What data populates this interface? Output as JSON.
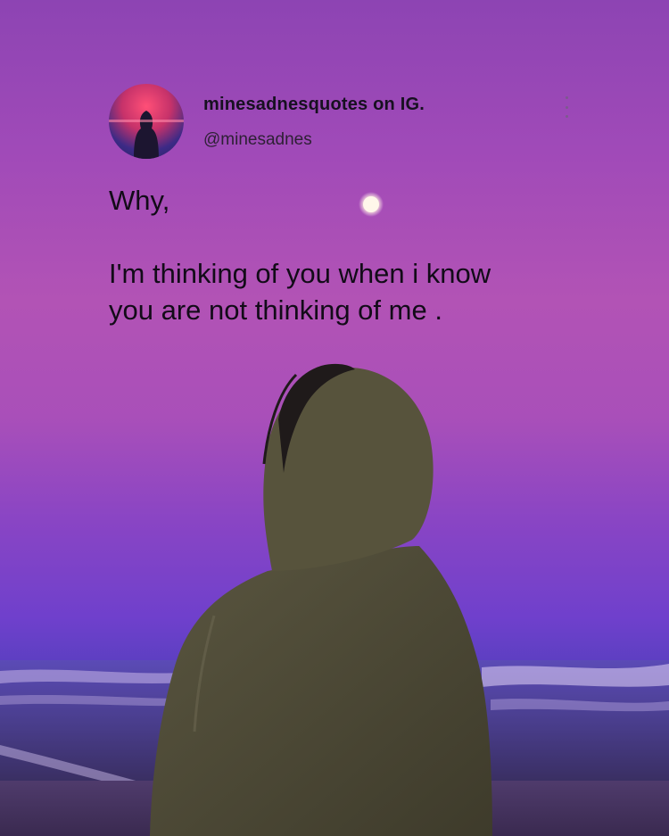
{
  "post": {
    "display_name": "minesadnesquotes on IG.",
    "handle": "@minesadnes",
    "more_icon": "more-vertical-icon",
    "quote": {
      "line1": "Why,",
      "line2": "I'm thinking of you when i know",
      "line3": "you are not thinking of me ."
    }
  },
  "colors": {
    "sky_top": "#8d44b3",
    "sky_mid": "#b253b5",
    "horizon": "#5a3fc0",
    "hoodie": "#4d4a35",
    "text": "#120b18"
  }
}
